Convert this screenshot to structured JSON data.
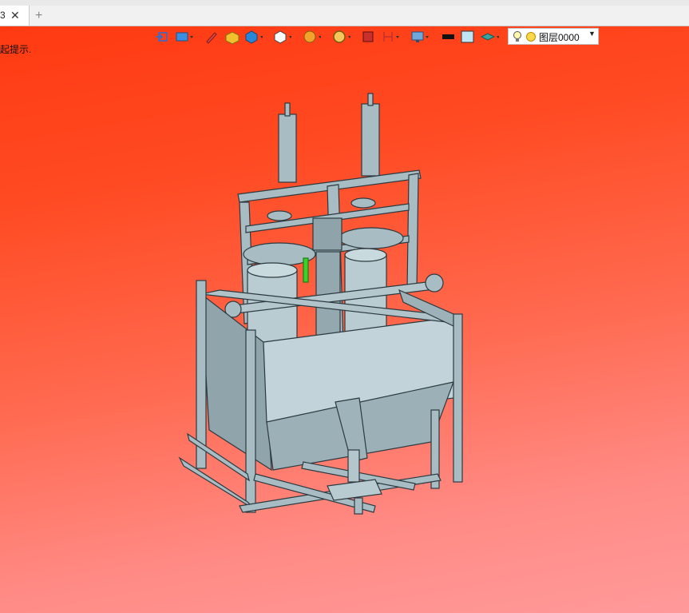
{
  "tabbar": {
    "active_tab": {
      "label": "3",
      "close_glyph": "✕"
    },
    "new_tab_glyph": "+"
  },
  "viewport": {
    "hint_text": "起提示.",
    "background_colors": {
      "top": "#ff3a12",
      "bottom": "#ff9a9a"
    },
    "model_color": "#9fb4bb"
  },
  "toolbar": {
    "icons": [
      "exit-icon",
      "view-orient-icon",
      "sketch-pen-icon",
      "solid-box-icon",
      "shaded-cube-icon",
      "wire-cube-icon",
      "section-icon",
      "zoom-icon",
      "render-icon",
      "measure-icon",
      "display-icon",
      "black-color-swatch",
      "light-blue-swatch",
      "layer-stack-icon"
    ],
    "layer_select": {
      "value": "图层0000"
    }
  }
}
